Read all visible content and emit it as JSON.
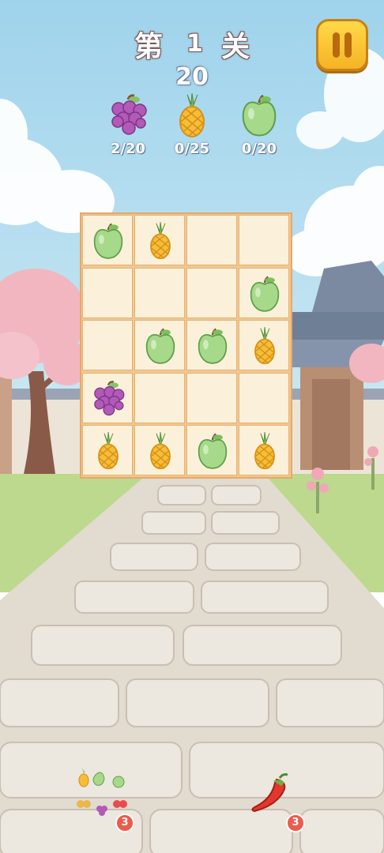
{
  "header": {
    "level_prefix": "第",
    "level_number": "1",
    "level_suffix": "关",
    "moves_left": "20"
  },
  "goals": [
    {
      "fruit": "grape",
      "count": "2/20"
    },
    {
      "fruit": "pineapple",
      "count": "0/25"
    },
    {
      "fruit": "apple",
      "count": "0/20"
    }
  ],
  "board": {
    "rows": 5,
    "cols": 4,
    "cells": [
      [
        "apple",
        "pineapple",
        "",
        ""
      ],
      [
        "",
        "",
        "",
        "apple"
      ],
      [
        "",
        "apple",
        "apple",
        "pineapple"
      ],
      [
        "grape",
        "",
        "",
        ""
      ],
      [
        "pineapple",
        "pineapple",
        "apple",
        "pineapple"
      ]
    ]
  },
  "boosters": [
    {
      "name": "shuffle",
      "count": "3"
    },
    {
      "name": "chili",
      "count": "3"
    }
  ],
  "colors": {
    "sky": "#a9d9ee",
    "grass": "#b8d98a",
    "path": "#e7e1d8",
    "board_bg": "#fbf1da",
    "board_border": "#e8a864",
    "pause_button": "#f7c232",
    "badge": "#ee5a4c"
  }
}
